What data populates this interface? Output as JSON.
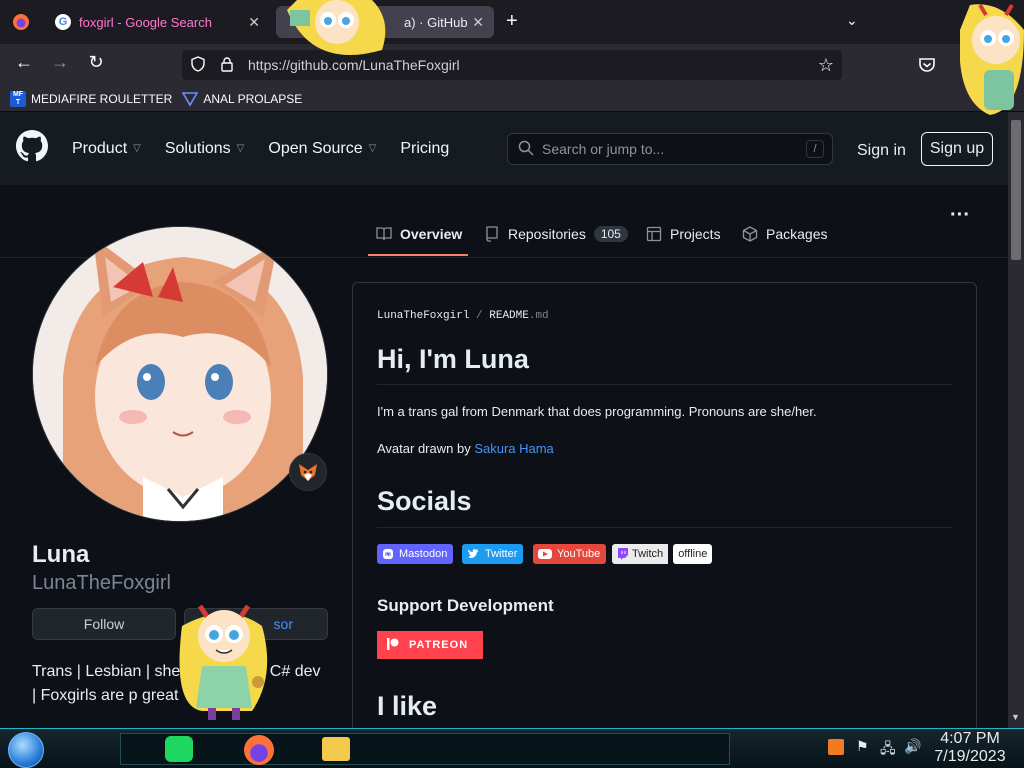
{
  "browser": {
    "tabs": [
      {
        "label": "foxgirl - Google Search",
        "active": false
      },
      {
        "label": "a) · GitHub",
        "active": true
      }
    ],
    "url": "https://github.com/LunaTheFoxgirl",
    "bookmarks": [
      {
        "label": "MEDIAFIRE ROULETTER"
      },
      {
        "label": "ANAL PROLAPSE"
      }
    ]
  },
  "header": {
    "nav": [
      "Product",
      "Solutions",
      "Open Source",
      "Pricing"
    ],
    "search_placeholder": "Search or jump to...",
    "search_key": "/",
    "signin": "Sign in",
    "signup": "Sign up"
  },
  "tabs": {
    "overview": "Overview",
    "repositories": "Repositories",
    "repo_count": "105",
    "projects": "Projects",
    "packages": "Packages",
    "more": "···"
  },
  "profile": {
    "name": "Luna",
    "username": "LunaTheFoxgirl",
    "follow": "Follow",
    "sponsor": "sor",
    "bio_line1": "Trans | Lesbian | she/",
    "bio_line1b": "& C# dev",
    "bio_line2": "| Foxgirls are p great"
  },
  "readme": {
    "crumb_user": "LunaTheFoxgirl",
    "crumb_sep": "/",
    "crumb_file": "README",
    "crumb_ext": ".md",
    "h_intro": "Hi, I'm Luna",
    "intro": "I'm a trans gal from Denmark that does programming. Pronouns are she/her.",
    "avatar_prefix": "Avatar drawn by ",
    "avatar_artist": "Sakura Hama",
    "h_socials": "Socials",
    "badges": {
      "mastodon": "Mastodon",
      "twitter": "Twitter",
      "youtube": "YouTube",
      "twitch": "Twitch",
      "twitch_status": "offline"
    },
    "h_support": "Support Development",
    "patreon": "PATREON",
    "h_like": "I like"
  },
  "taskbar": {
    "time": "4:07 PM",
    "date": "7/19/2023"
  },
  "colors": {
    "accent_underline": "#f78166",
    "link": "#4493f8",
    "mastodon": "#6364ff",
    "twitter": "#1d9bf0",
    "youtube": "#e5473c",
    "patreon": "#ff424d"
  }
}
